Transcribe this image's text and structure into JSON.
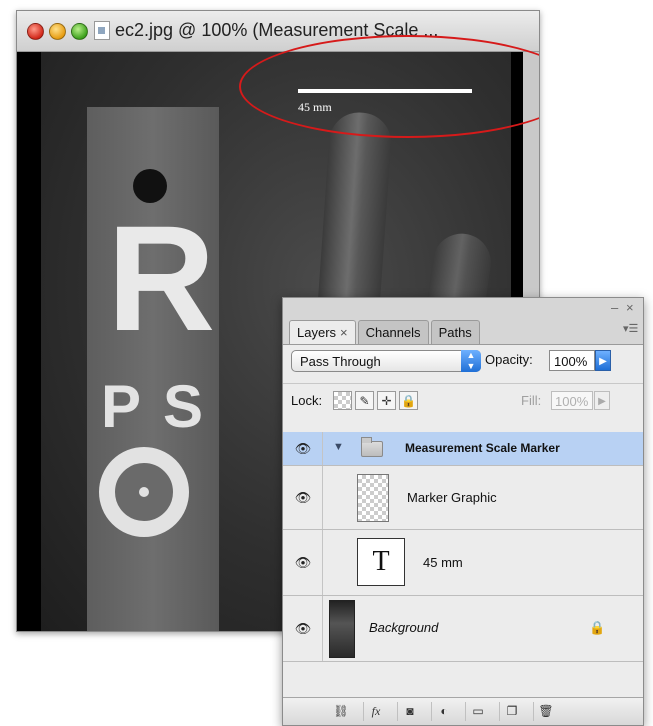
{
  "document_window": {
    "title": "ec2.jpg @ 100% (Measurement Scale ...",
    "scale_label": "45 mm",
    "xray_letters": {
      "big": "R",
      "left": "P",
      "right": "S"
    }
  },
  "layers_panel": {
    "tabs": [
      {
        "label": "Layers",
        "close": "×"
      },
      {
        "label": "Channels"
      },
      {
        "label": "Paths"
      }
    ],
    "panel_controls": {
      "minimize": "–",
      "close": "×",
      "menu": "▾☰"
    },
    "blend_mode": "Pass Through",
    "opacity_label": "Opacity:",
    "opacity_value": "100%",
    "lock_label": "Lock:",
    "fill_label": "Fill:",
    "fill_value": "100%",
    "layers": [
      {
        "name": "Measurement Scale Marker",
        "type": "group",
        "visible": true,
        "expanded": true,
        "selected": true
      },
      {
        "name": "Marker Graphic",
        "type": "pixel",
        "visible": true
      },
      {
        "name": "45 mm",
        "type": "text",
        "thumb": "T",
        "visible": true
      },
      {
        "name": "Background",
        "type": "background",
        "visible": true,
        "locked": true
      }
    ],
    "bottom_icons": [
      "link-icon",
      "fx-icon",
      "mask-icon",
      "adjustment-icon",
      "new-group-icon",
      "new-layer-icon",
      "trash-icon"
    ],
    "bottom_labels": {
      "fx": "fx"
    }
  },
  "colors": {
    "annotation": "#d61a1a",
    "selected_row": "#b8d1f3",
    "accent_blue": "#1f6fd6"
  }
}
